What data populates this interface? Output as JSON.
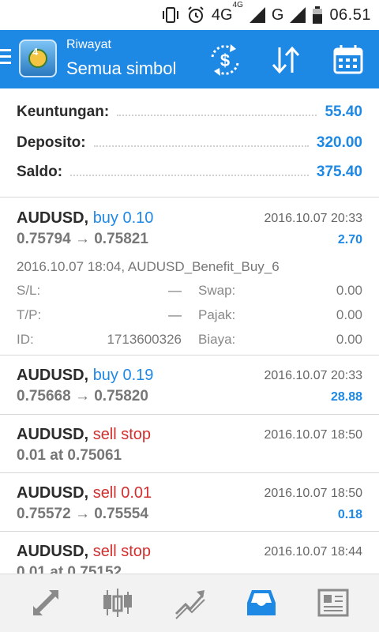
{
  "status_bar": {
    "network_primary": "4G",
    "network_sup": "4G",
    "network_secondary": "G",
    "time": "06.51",
    "icons": [
      "vibrate-icon",
      "alarm-icon",
      "signal-icon",
      "battery-icon"
    ]
  },
  "toolbar": {
    "title": "Riwayat",
    "subtitle": "Semua simbol",
    "logo_number": "4",
    "actions": [
      "currency-exchange-icon",
      "sort-icon",
      "calendar-icon"
    ]
  },
  "summary": [
    {
      "label": "Keuntungan:",
      "value": "55.40"
    },
    {
      "label": "Deposito:",
      "value": "320.00"
    },
    {
      "label": "Saldo:",
      "value": "375.40"
    }
  ],
  "deals": [
    {
      "symbol": "AUDUSD,",
      "action": "buy 0.10",
      "side": "buy",
      "time": "2016.10.07 20:33",
      "prices": "0.75794 → 0.75821",
      "profit": "2.70",
      "comment": "2016.10.07 18:04, AUDUSD_Benefit_Buy_6",
      "sl_label": "S/L:",
      "sl_value": "—",
      "tp_label": "T/P:",
      "tp_value": "—",
      "id_label": "ID:",
      "id_value": "1713600326",
      "swap_label": "Swap:",
      "swap_value": "0.00",
      "tax_label": "Pajak:",
      "tax_value": "0.00",
      "fee_label": "Biaya:",
      "fee_value": "0.00"
    },
    {
      "symbol": "AUDUSD,",
      "action": "buy 0.19",
      "side": "buy",
      "time": "2016.10.07 20:33",
      "prices": "0.75668 → 0.75820",
      "profit": "28.88"
    },
    {
      "symbol": "AUDUSD,",
      "action": "sell stop",
      "side": "sell",
      "time": "2016.10.07 18:50",
      "prices": "0.01 at 0.75061",
      "profit": ""
    },
    {
      "symbol": "AUDUSD,",
      "action": "sell 0.01",
      "side": "sell",
      "time": "2016.10.07 18:50",
      "prices": "0.75572 → 0.75554",
      "profit": "0.18"
    },
    {
      "symbol": "AUDUSD,",
      "action": "sell stop",
      "side": "sell",
      "time": "2016.10.07 18:44",
      "prices": "0.01 at 0.75152",
      "profit": ""
    }
  ],
  "bottom_nav": [
    "quotes-icon",
    "chart-icon",
    "trade-icon",
    "history-icon",
    "news-icon"
  ],
  "colors": {
    "accent": "#1e88e5",
    "sell": "#d32f2f",
    "active_nav": "#1e88e5",
    "inactive_nav": "#8a8a8a"
  }
}
